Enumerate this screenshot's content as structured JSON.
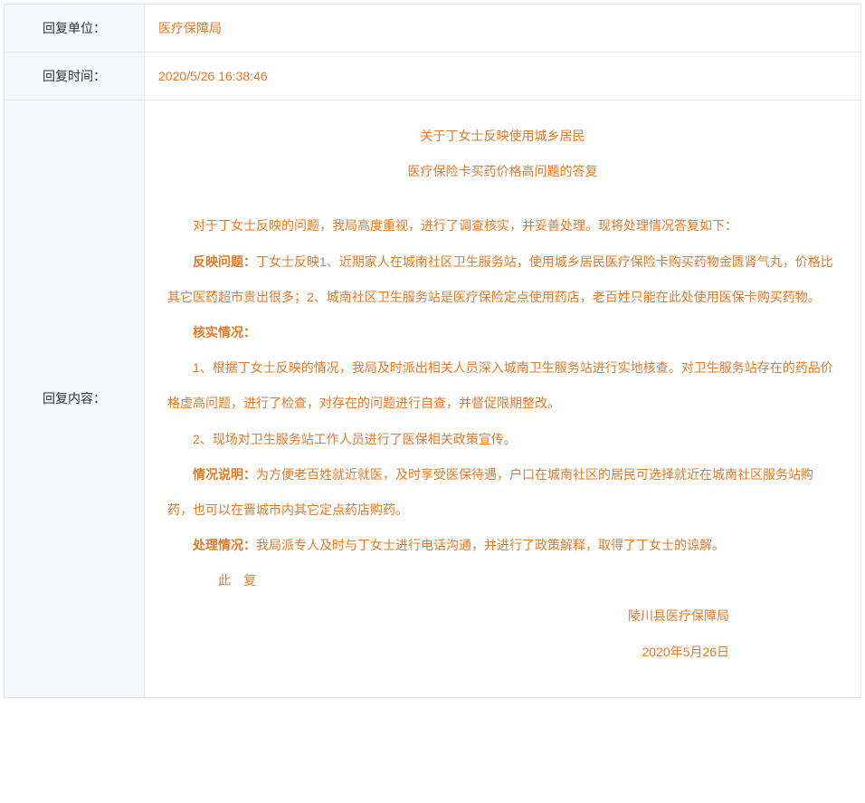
{
  "labels": {
    "unit": "回复单位：",
    "time": "回复时间：",
    "content": "回复内容："
  },
  "values": {
    "unit": "医疗保障局",
    "time": "2020/5/26 16:38:46"
  },
  "content": {
    "title_line1": "关于丁女士反映使用城乡居民",
    "title_line2": "医疗保险卡买药价格高问题的答复",
    "intro": "对于丁女士反映的问题，我局高度重视，进行了调查核实，并妥善处理。现将处理情况答复如下：",
    "problem_label": "反映问题：",
    "problem_text": "丁女士反映1、近期家人在城南社区卫生服务站，使用城乡居民医疗保险卡购买药物金匮肾气丸，价格比其它医药超市贵出很多；2、城南社区卫生服务站是医疗保险定点使用药店，老百姓只能在此处使用医保卡购买药物。",
    "verify_label": "核实情况：",
    "verify_item1": "1、根据丁女士反映的情况，我局及时派出相关人员深入城南卫生服务站进行实地核查。对卫生服务站存在的药品价格虚高问题，进行了检查，对存在的问题进行自查，并督促限期整改。",
    "verify_item2": "2、现场对卫生服务站工作人员进行了医保相关政策宣传。",
    "explain_label": "情况说明：",
    "explain_text": "为方便老百姓就近就医，及时享受医保待遇，户口在城南社区的居民可选择就近在城南社区服务站购药，也可以在晋城市内其它定点药店购药。",
    "handle_label": "处理情况：",
    "handle_text": "我局派专人及时与丁女士进行电话沟通，并进行了政策解释，取得了丁女士的谅解。",
    "closing": "此 复",
    "signature": "陵川县医疗保障局",
    "date": "2020年5月26日"
  }
}
